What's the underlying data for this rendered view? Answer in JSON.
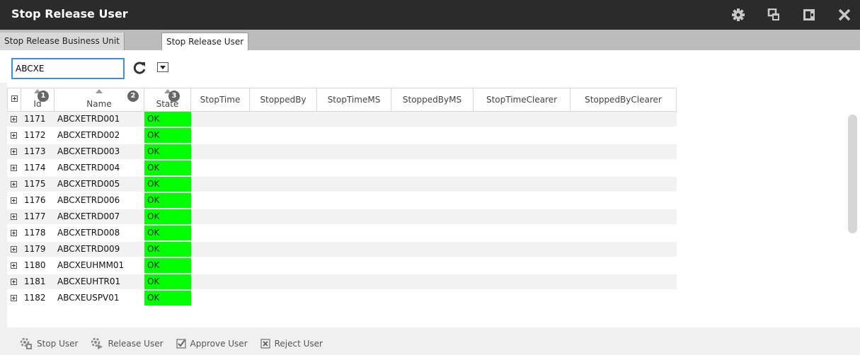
{
  "window": {
    "title": "Stop Release User",
    "icons": [
      "gear-icon",
      "restore-icon",
      "pin-icon",
      "close-icon"
    ]
  },
  "tabs": [
    {
      "label": "Stop Release Business Unit",
      "active": false
    },
    {
      "label": "Stop Release User",
      "active": true
    }
  ],
  "toolbar": {
    "search_value": "ABCXE",
    "refresh_icon": "refresh-icon",
    "dropdown_icon": "chevron-down-icon"
  },
  "grid": {
    "columns": [
      {
        "label": "Id",
        "sort_badge": "1"
      },
      {
        "label": "Name",
        "sort_badge": "2"
      },
      {
        "label": "State",
        "sort_badge": "3"
      },
      {
        "label": "StopTime"
      },
      {
        "label": "StoppedBy"
      },
      {
        "label": "StopTimeMS"
      },
      {
        "label": "StoppedByMS"
      },
      {
        "label": "StopTimeClearer"
      },
      {
        "label": "StoppedByClearer"
      }
    ],
    "rows": [
      {
        "id": "1171",
        "name": "ABCXETRD001",
        "state": "OK"
      },
      {
        "id": "1172",
        "name": "ABCXETRD002",
        "state": "OK"
      },
      {
        "id": "1173",
        "name": "ABCXETRD003",
        "state": "OK"
      },
      {
        "id": "1174",
        "name": "ABCXETRD004",
        "state": "OK"
      },
      {
        "id": "1175",
        "name": "ABCXETRD005",
        "state": "OK"
      },
      {
        "id": "1176",
        "name": "ABCXETRD006",
        "state": "OK"
      },
      {
        "id": "1177",
        "name": "ABCXETRD007",
        "state": "OK"
      },
      {
        "id": "1178",
        "name": "ABCXETRD008",
        "state": "OK"
      },
      {
        "id": "1179",
        "name": "ABCXETRD009",
        "state": "OK"
      },
      {
        "id": "1180",
        "name": "ABCXEUHMM01",
        "state": "OK"
      },
      {
        "id": "1181",
        "name": "ABCXEUHTR01",
        "state": "OK"
      },
      {
        "id": "1182",
        "name": "ABCXEUSPV01",
        "state": "OK"
      }
    ],
    "state_ok_color": "#00ff00"
  },
  "actions": {
    "stop_user": "Stop User",
    "release_user": "Release User",
    "approve_user": "Approve User",
    "reject_user": "Reject User"
  },
  "colors": {
    "titlebar": "#2b2b2b",
    "search_border": "#3c8fd8"
  }
}
